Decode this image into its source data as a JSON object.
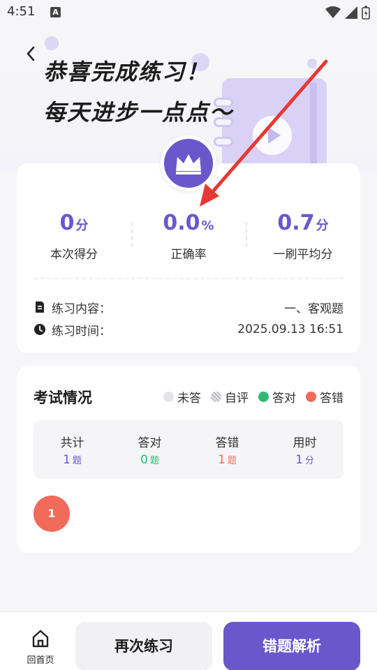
{
  "status": {
    "time": "4:51",
    "notif_icon": "A"
  },
  "hero": {
    "line1": "恭喜完成练习！",
    "line2": "每天进步一点点～"
  },
  "stats": [
    {
      "value": "0",
      "unit": "分",
      "label": "本次得分"
    },
    {
      "value": "0.0",
      "unit": "%",
      "label": "正确率"
    },
    {
      "value": "0.7",
      "unit": "分",
      "label": "一刷平均分"
    }
  ],
  "info": {
    "content_label": "练习内容：",
    "content_value": "一、客观题",
    "time_label": "练习时间：",
    "time_value": "2025.09.13 16:51"
  },
  "exam": {
    "title": "考试情况",
    "legend": {
      "unanswered": "未答",
      "self": "自评",
      "correct": "答对",
      "wrong": "答错"
    },
    "summary": [
      {
        "label": "共计",
        "value": "1",
        "unit": "题"
      },
      {
        "label": "答对",
        "value": "0",
        "unit": "题"
      },
      {
        "label": "答错",
        "value": "1",
        "unit": "题"
      },
      {
        "label": "用时",
        "value": "1",
        "unit": "分"
      }
    ],
    "questions": [
      "1"
    ]
  },
  "bottom": {
    "home_label": "回首页",
    "retry_label": "再次练习",
    "analysis_label": "错题解析"
  },
  "colors": {
    "accent": "#6a57cc",
    "correct": "#2fba73",
    "wrong": "#f26a5a",
    "annotation_arrow": "#e53935"
  }
}
